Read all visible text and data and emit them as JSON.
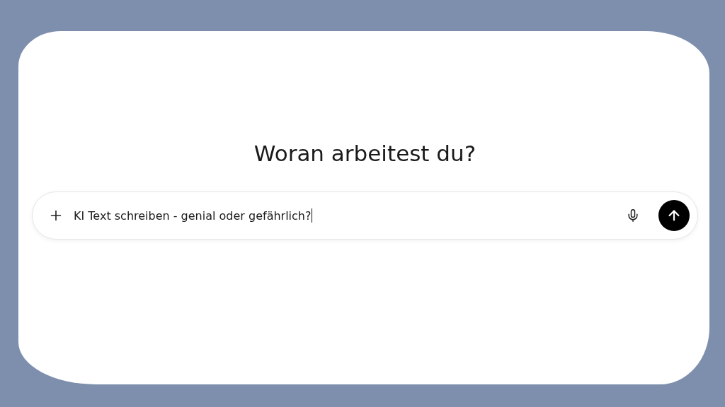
{
  "heading": "Woran arbeitest du?",
  "composer": {
    "value": "KI Text schreiben - genial oder gefährlich?"
  }
}
